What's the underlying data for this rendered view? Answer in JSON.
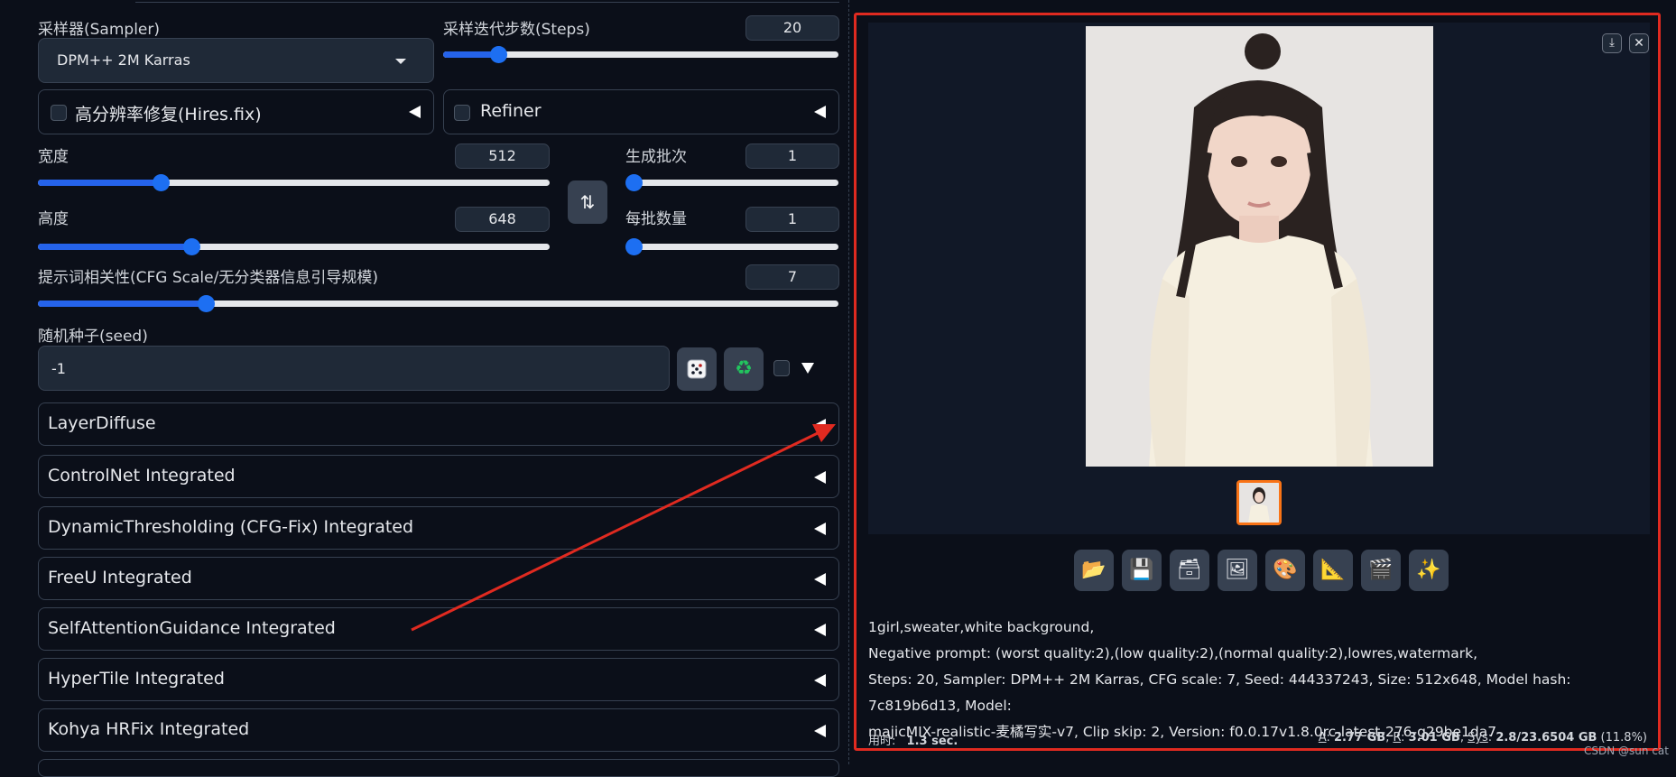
{
  "sampler": {
    "label": "采样器(Sampler)",
    "value": "DPM++ 2M Karras"
  },
  "steps": {
    "label": "采样迭代步数(Steps)",
    "value": "20",
    "fraction": 0.14
  },
  "hires": {
    "label": "高分辨率修复(Hires.fix)"
  },
  "refiner": {
    "label": "Refiner"
  },
  "width": {
    "label": "宽度",
    "value": "512",
    "fraction": 0.24
  },
  "height": {
    "label": "高度",
    "value": "648",
    "fraction": 0.3
  },
  "batch_count": {
    "label": "生成批次",
    "value": "1",
    "fraction": 0.0
  },
  "batch_size": {
    "label": "每批数量",
    "value": "1",
    "fraction": 0.0
  },
  "swap_icon": "swap-arrows-icon",
  "cfg": {
    "label": "提示词相关性(CFG Scale/无分类器信息引导规模)",
    "value": "7",
    "fraction": 0.21
  },
  "seed": {
    "label": "随机种子(seed)",
    "value": "-1"
  },
  "accordions": [
    "LayerDiffuse",
    "ControlNet Integrated",
    "DynamicThresholding (CFG-Fix) Integrated",
    "FreeU Integrated",
    "SelfAttentionGuidance Integrated",
    "HyperTile Integrated",
    "Kohya HRFix Integrated"
  ],
  "output": {
    "toolbar_icons": [
      "folder-icon",
      "save-icon",
      "zip-icon",
      "send-to-img2img-icon",
      "send-to-inpaint-icon",
      "send-to-extras-icon",
      "clapper-icon",
      "sparkles-icon"
    ],
    "info_lines": [
      "1girl,sweater,white background,",
      "Negative prompt: (worst quality:2),(low quality:2),(normal quality:2),lowres,watermark,",
      "Steps: 20, Sampler: DPM++ 2M Karras, CFG scale: 7, Seed: 444337243, Size: 512x648, Model hash: 7c819b6d13, Model:",
      "majicMIX-realistic-麦橘写实-v7, Clip skip: 2, Version: f0.0.17v1.8.0rc-latest-276-g29be1da7"
    ],
    "time_label": "用时:",
    "time_value": "1.3 sec.",
    "mem_a_label": "A",
    "mem_a_value": "2.77 GB",
    "mem_r_label": "R",
    "mem_r_value": "3.01 GB",
    "mem_sys_label": "Sys",
    "mem_sys_value": "2.8/23.6504 GB",
    "mem_pct": "(11.8%)"
  },
  "watermark": "CSDN @sun cat",
  "colors": {
    "accent": "#1d6ff2",
    "annotation_red": "#e02a20",
    "thumb_border": "#f97316"
  }
}
